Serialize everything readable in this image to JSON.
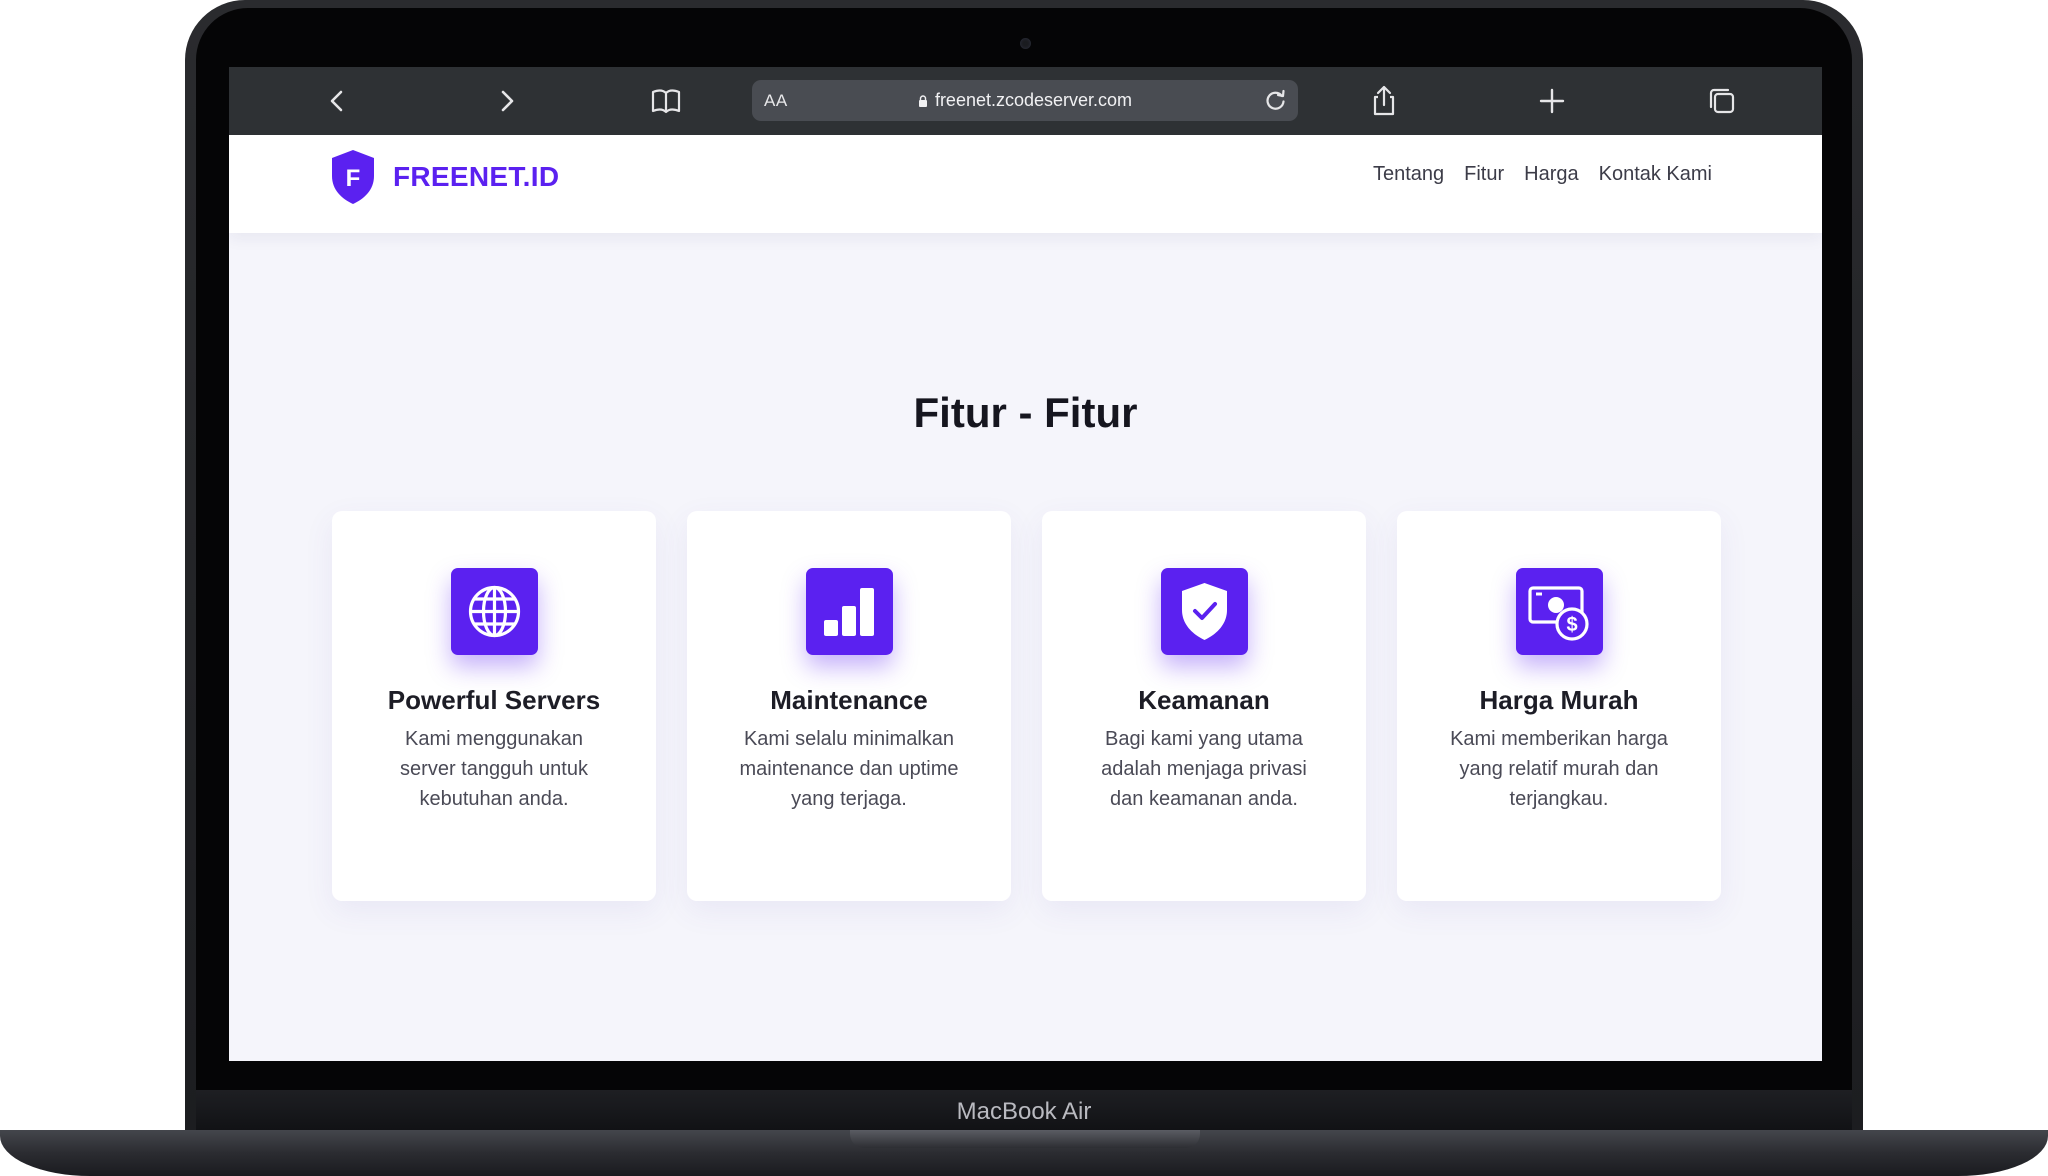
{
  "browser": {
    "aa_label": "AA",
    "url": "freenet.zcodeserver.com"
  },
  "site": {
    "brand": "FREENET.ID",
    "logo_letter": "F",
    "nav": [
      "Tentang",
      "Fitur",
      "Harga",
      "Kontak Kami"
    ]
  },
  "features": {
    "title": "Fitur - Fitur",
    "items": [
      {
        "icon": "globe-icon",
        "title": "Powerful Servers",
        "description": "Kami menggunakan server tangguh untuk kebutuhan anda."
      },
      {
        "icon": "bar-chart-icon",
        "title": "Maintenance",
        "description": "Kami selalu minimalkan maintenance dan uptime yang terjaga."
      },
      {
        "icon": "shield-check-icon",
        "title": "Keamanan",
        "description": "Bagi kami yang utama adalah menjaga privasi dan keamanan anda."
      },
      {
        "icon": "money-icon",
        "title": "Harga Murah",
        "description": "Kami memberikan harga yang relatif murah dan terjangkau."
      }
    ]
  },
  "device": {
    "model": "MacBook Air"
  },
  "colors": {
    "brand": "#5b21f0",
    "toolbar": "#2e3134",
    "page_background": "#f5f5fb"
  }
}
